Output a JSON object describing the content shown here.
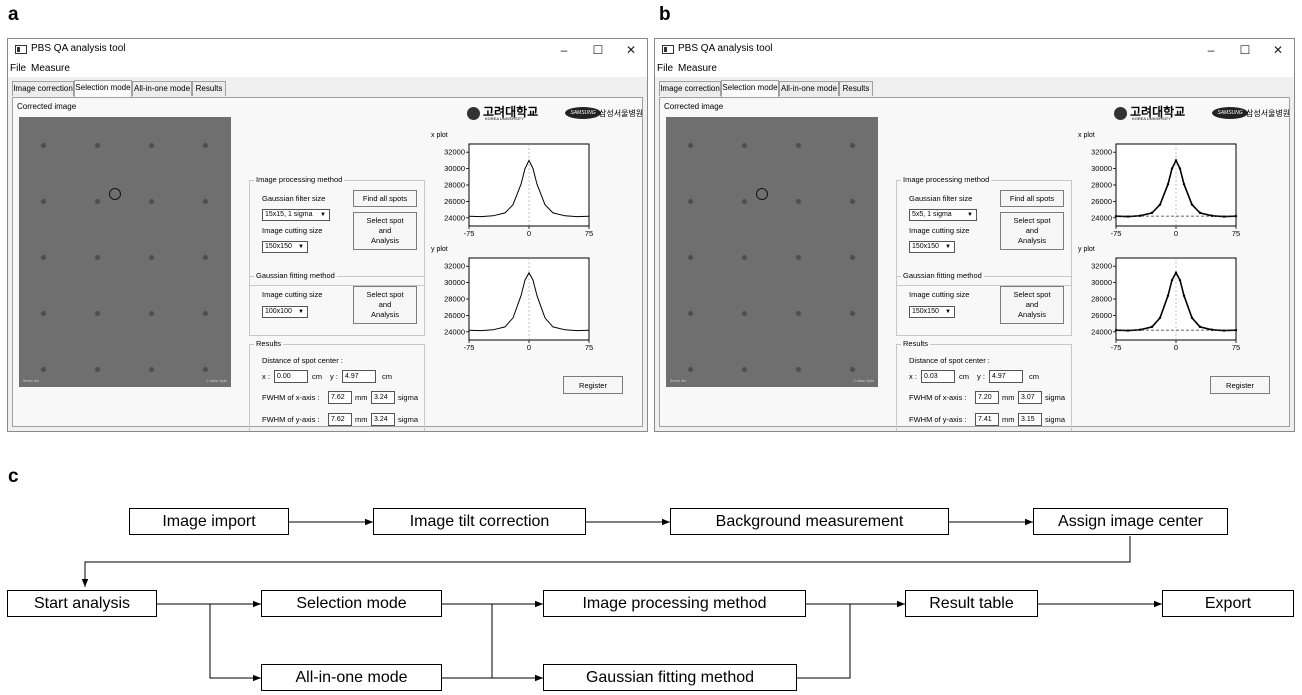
{
  "panel_labels": {
    "a": "a",
    "b": "b",
    "c": "c"
  },
  "windows": [
    {
      "title": "PBS QA analysis tool",
      "controls": {
        "minimize": "–",
        "maximize": "☐",
        "close": "✕"
      },
      "menu": [
        "File",
        "Measure"
      ],
      "tabs": [
        "Image correction",
        "Selection mode",
        "All-in-one mode",
        "Results"
      ],
      "active_tab": "Selection mode",
      "image_label": "Corrected image",
      "image_caption_left": "5mm/ div",
      "image_caption_right": "2 dots/ 4pts",
      "logos": {
        "korea_univ": "고려대학교",
        "korea_univ_sub": "KOREA UNIVERSITY",
        "samsung": "SAMSUNG",
        "hospital": "삼성서울병원"
      },
      "processing": {
        "title": "Image processing method",
        "filter_label": "Gaussian filter size",
        "filter_value": "15x15, 1 sigma",
        "cut_label": "Image cutting size",
        "cut_value": "150x150",
        "find_btn": "Find all spots",
        "select_btn": [
          "Select spot",
          "and",
          "Analysis"
        ]
      },
      "fitting": {
        "title": "Gaussian fitting method",
        "cut_label": "Image cutting size",
        "cut_value": "100x100",
        "select_btn": [
          "Select spot",
          "and",
          "Analysis"
        ]
      },
      "results": {
        "title": "Results",
        "distance_label": "Distance of spot center :",
        "x_label": "x :",
        "x_value": "0.00",
        "y_label": "y :",
        "y_value": "4.97",
        "unit_cm": "cm",
        "fwhm_x_label": "FWHM of x-axis :",
        "fwhm_x_mm": "7.62",
        "fwhm_x_sigma": "3.24",
        "fwhm_y_label": "FWHM of y-axis :",
        "fwhm_y_mm": "7.62",
        "fwhm_y_sigma": "3.24",
        "unit_mm": "mm",
        "unit_sigma": "sigma"
      },
      "plots": {
        "x_title": "x plot",
        "y_title": "y plot"
      },
      "register_btn": "Register",
      "fit_overlay": false
    },
    {
      "title": "PBS QA analysis tool",
      "controls": {
        "minimize": "–",
        "maximize": "☐",
        "close": "✕"
      },
      "menu": [
        "File",
        "Measure"
      ],
      "tabs": [
        "Image correction",
        "Selection mode",
        "All-in-one mode",
        "Results"
      ],
      "active_tab": "Selection mode",
      "image_label": "Corrected image",
      "image_caption_left": "5mm/ div",
      "image_caption_right": "2 dots/ 4pts",
      "logos": {
        "korea_univ": "고려대학교",
        "korea_univ_sub": "KOREA UNIVERSITY",
        "samsung": "SAMSUNG",
        "hospital": "삼성서울병원"
      },
      "processing": {
        "title": "Image processing method",
        "filter_label": "Gaussian filter size",
        "filter_value": "5x5, 1 sigma",
        "cut_label": "Image cutting size",
        "cut_value": "150x150",
        "find_btn": "Find all spots",
        "select_btn": [
          "Select spot",
          "and",
          "Analysis"
        ]
      },
      "fitting": {
        "title": "Gaussian fitting method",
        "cut_label": "Image cutting size",
        "cut_value": "150x150",
        "select_btn": [
          "Select spot",
          "and",
          "Analysis"
        ]
      },
      "results": {
        "title": "Results",
        "distance_label": "Distance of spot center :",
        "x_label": "x :",
        "x_value": "0.03",
        "y_label": "y :",
        "y_value": "4.97",
        "unit_cm": "cm",
        "fwhm_x_label": "FWHM of x-axis :",
        "fwhm_x_mm": "7.20",
        "fwhm_x_sigma": "3.07",
        "fwhm_y_label": "FWHM of y-axis :",
        "fwhm_y_mm": "7.41",
        "fwhm_y_sigma": "3.15",
        "unit_mm": "mm",
        "unit_sigma": "sigma"
      },
      "plots": {
        "x_title": "x plot",
        "y_title": "y plot"
      },
      "register_btn": "Register",
      "fit_overlay": true
    }
  ],
  "chart_data": [
    {
      "type": "line",
      "title": "x plot",
      "x": [
        -75,
        -60,
        -45,
        -30,
        -20,
        -10,
        -5,
        0,
        5,
        10,
        20,
        30,
        45,
        60,
        75
      ],
      "series": [
        {
          "values": [
            24200,
            24150,
            24250,
            24600,
            25600,
            28100,
            30000,
            31000,
            30000,
            28100,
            25600,
            24600,
            24250,
            24150,
            24200
          ]
        }
      ],
      "xticks": [
        -75,
        0,
        75
      ],
      "yticks": [
        24000,
        26000,
        28000,
        30000,
        32000
      ],
      "xlim": [
        -75,
        75
      ],
      "ylim": [
        23000,
        33000
      ]
    },
    {
      "type": "line",
      "title": "y plot",
      "x": [
        -75,
        -60,
        -45,
        -30,
        -20,
        -10,
        -5,
        0,
        5,
        10,
        20,
        30,
        45,
        60,
        75
      ],
      "series": [
        {
          "values": [
            24200,
            24150,
            24250,
            24600,
            25700,
            28400,
            30300,
            31200,
            30300,
            28400,
            25700,
            24600,
            24250,
            24150,
            24200
          ]
        }
      ],
      "xticks": [
        -75,
        0,
        75
      ],
      "yticks": [
        24000,
        26000,
        28000,
        30000,
        32000
      ],
      "xlim": [
        -75,
        75
      ],
      "ylim": [
        23000,
        33000
      ]
    }
  ],
  "flowchart": {
    "nodes": {
      "import": "Image import",
      "tilt": "Image tilt correction",
      "background": "Background measurement",
      "center": "Assign image center",
      "start": "Start analysis",
      "selection": "Selection mode",
      "allinone": "All-in-one mode",
      "processing": "Image processing method",
      "gaussian": "Gaussian fitting method",
      "result": "Result table",
      "export": "Export"
    }
  }
}
